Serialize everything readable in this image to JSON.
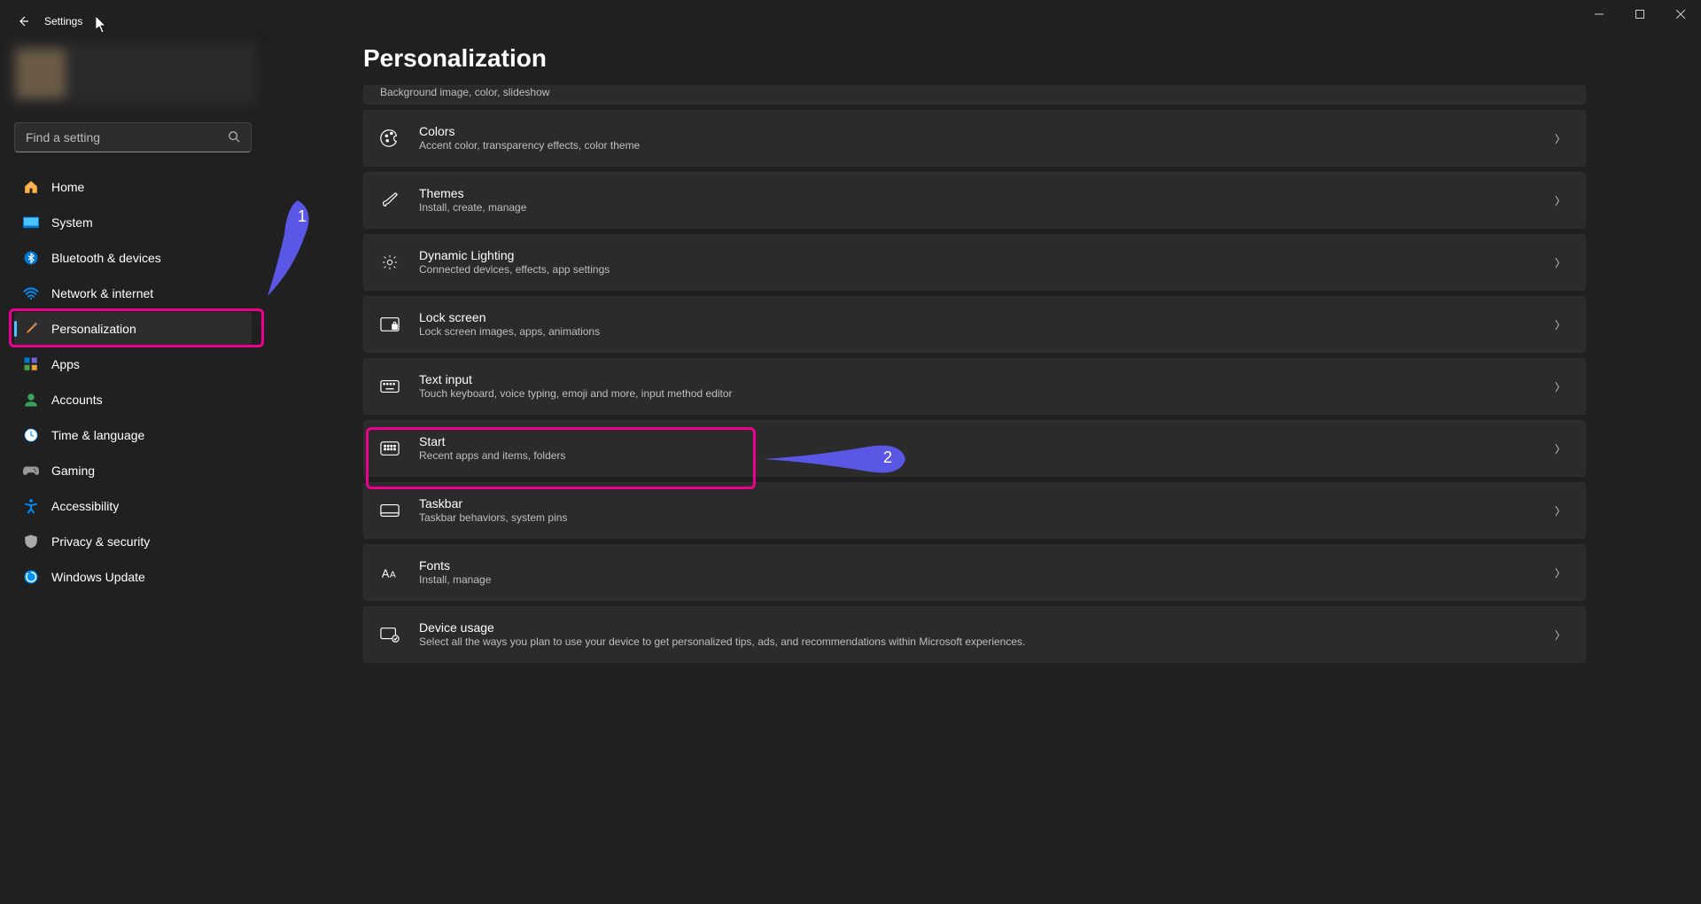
{
  "app_title": "Settings",
  "search_placeholder": "Find a setting",
  "page_title": "Personalization",
  "nav": [
    {
      "key": "home",
      "label": "Home"
    },
    {
      "key": "system",
      "label": "System"
    },
    {
      "key": "bluetooth",
      "label": "Bluetooth & devices"
    },
    {
      "key": "network",
      "label": "Network & internet"
    },
    {
      "key": "personalization",
      "label": "Personalization"
    },
    {
      "key": "apps",
      "label": "Apps"
    },
    {
      "key": "accounts",
      "label": "Accounts"
    },
    {
      "key": "time",
      "label": "Time & language"
    },
    {
      "key": "gaming",
      "label": "Gaming"
    },
    {
      "key": "accessibility",
      "label": "Accessibility"
    },
    {
      "key": "privacy",
      "label": "Privacy & security"
    },
    {
      "key": "update",
      "label": "Windows Update"
    }
  ],
  "cards": {
    "bg_sub": "Background image, color, slideshow",
    "colors_title": "Colors",
    "colors_sub": "Accent color, transparency effects, color theme",
    "themes_title": "Themes",
    "themes_sub": "Install, create, manage",
    "dyn_title": "Dynamic Lighting",
    "dyn_sub": "Connected devices, effects, app settings",
    "lock_title": "Lock screen",
    "lock_sub": "Lock screen images, apps, animations",
    "text_title": "Text input",
    "text_sub": "Touch keyboard, voice typing, emoji and more, input method editor",
    "start_title": "Start",
    "start_sub": "Recent apps and items, folders",
    "task_title": "Taskbar",
    "task_sub": "Taskbar behaviors, system pins",
    "fonts_title": "Fonts",
    "fonts_sub": "Install, manage",
    "dev_title": "Device usage",
    "dev_sub": "Select all the ways you plan to use your device to get personalized tips, ads, and recommendations within Microsoft experiences."
  },
  "annotations": {
    "pointer1": "1",
    "pointer2": "2"
  }
}
